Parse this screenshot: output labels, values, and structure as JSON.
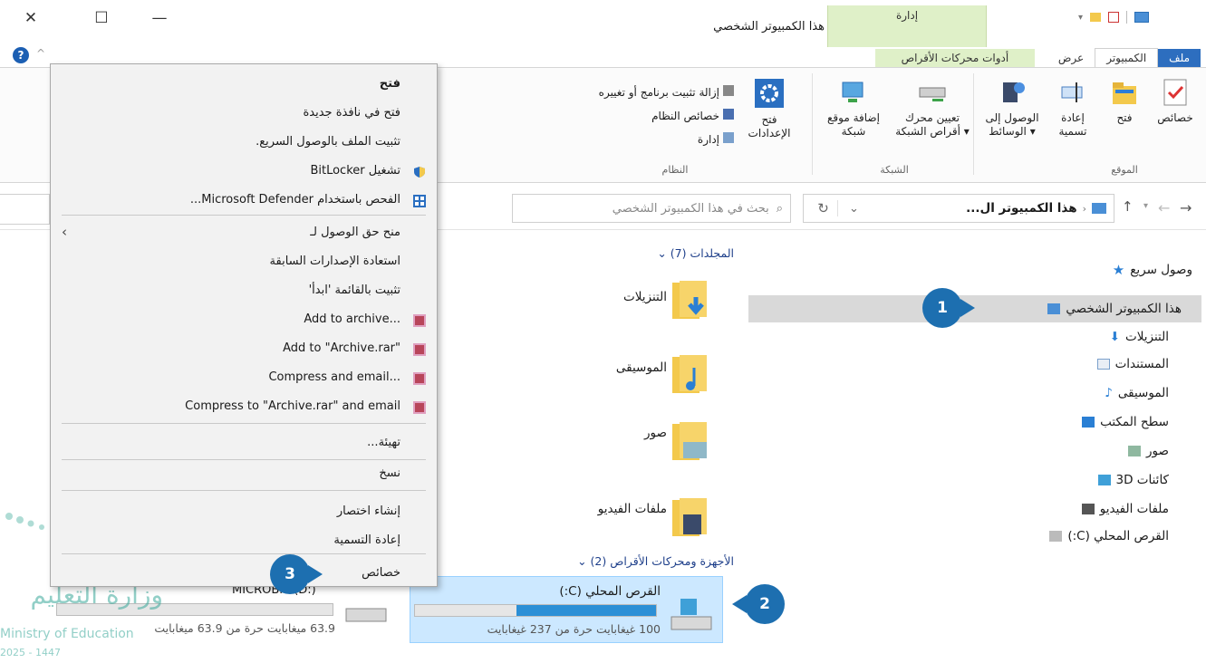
{
  "window": {
    "title": "هذا الكمبيوتر الشخصي",
    "contextual_tab_group": "إدارة",
    "minimize": "—",
    "maximize": "☐",
    "close": "✕",
    "help": "?",
    "collapse": "^"
  },
  "tabs": [
    "ملف",
    "الكمبيوتر",
    "عرض",
    "أدوات محركات الأقراص"
  ],
  "ribbon": {
    "location": {
      "label": "الموقع",
      "properties": "خصائص",
      "open": "فتح",
      "rename_1": "إعادة",
      "rename_2": "تسمية",
      "media_1": "الوصول إلى",
      "media_2": "الوسائط"
    },
    "network": {
      "label": "الشبكة",
      "map_drive_1": "تعيين محرك",
      "map_drive_2": "أقراص الشبكة",
      "add_location_1": "إضافة موقع",
      "add_location_2": "شبكة"
    },
    "system": {
      "label": "النظام",
      "open_settings_1": "فتح",
      "open_settings_2": "الإعدادات",
      "uninstall": "إزالة تثبيت برنامج أو تغييره",
      "system_properties": "خصائص النظام",
      "manage": "إدارة"
    }
  },
  "addressbar": {
    "path": "هذا الكمبيوتر ال...",
    "search_placeholder": "بحث في هذا الكمبيوتر الشخصي"
  },
  "nav": {
    "quick_access": "وصول سريع",
    "items": [
      "هذا الكمبيوتر الشخصي",
      "التنزيلات",
      "المستندات",
      "الموسيقى",
      "سطح المكتب",
      "صور",
      "كائنات 3D",
      "ملفات الفيديو",
      "القرص المحلي (C:)"
    ]
  },
  "content": {
    "folders_header": "المجلدات (7)",
    "folders": [
      "التنزيلات",
      "الموسيقى",
      "صور",
      "ملفات الفيديو"
    ],
    "drives_header": "الأجهزة ومحركات الأقراص (2)",
    "drive_c": {
      "name": "القرص المحلي (C:)",
      "free": "100 غيغابايت حرة من 237 غيغابايت",
      "used_fraction": 0.58
    },
    "drive_d": {
      "name": "MICROBIT (D:)",
      "free": "63.9 ميغابايت حرة من 63.9 ميغابايت",
      "used_fraction": 0.0
    }
  },
  "context_menu": {
    "items": [
      "فتح",
      "فتح في نافذة جديدة",
      "تثبيت الملف بالوصول السريع.",
      "تشغيل BitLocker",
      "الفحص باستخدام Microsoft Defender...",
      "منح حق الوصول لـ",
      "استعادة الإصدارات السابقة",
      "تثبيت بالقائمة 'ابدأ'",
      "Add to archive...",
      "Add to \"Archive.rar\"",
      "Compress and email...",
      "Compress to \"Archive.rar\" and email",
      "تهيئة...",
      "نسخ",
      "إنشاء اختصار",
      "إعادة التسمية",
      "خصائص"
    ]
  },
  "callouts": [
    "1",
    "2",
    "3"
  ],
  "watermark": {
    "ar": "وزارة التعليم",
    "en": "Ministry of Education",
    "year": "2025 - 1447"
  },
  "colors": {
    "accent": "#1d6fb0",
    "file_tab": "#2d6ebf",
    "contextual": "#dff0c8",
    "selection": "#cce8ff"
  }
}
